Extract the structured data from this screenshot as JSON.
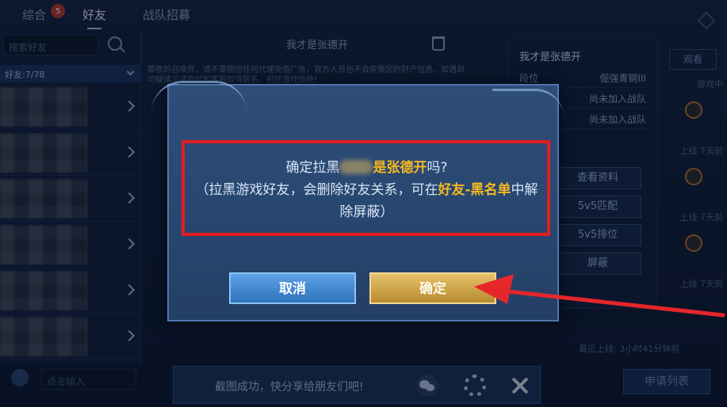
{
  "tabs": {
    "items": [
      {
        "label": "综合"
      },
      {
        "label": "好友"
      },
      {
        "label": "战队招募"
      }
    ],
    "badge": "5"
  },
  "friends": {
    "search_placeholder": "搜索好友",
    "count_label": "好友:7/78",
    "input_placeholder": "点击输入"
  },
  "chat": {
    "title": "我才是张德开",
    "notice": "尊敬的召唤师，请不要相信任何代理充值广告，官方人员也不会索要您的财产信息，如遇到可疑情况请及时和客服取得联系，祝您游戏愉快！"
  },
  "profile": {
    "name": "我才是张德开",
    "rows": [
      {
        "key": "段位",
        "value": "倔强青铜III"
      },
      {
        "key": "",
        "value": "尚未加入战队"
      },
      {
        "key": "",
        "value": "尚未加入战队"
      }
    ],
    "buttons": [
      {
        "label": "查看资料"
      },
      {
        "label": "5v5匹配"
      },
      {
        "label": "5v5排位"
      },
      {
        "label": "屏蔽"
      }
    ],
    "far_right_button": "观看",
    "online_lines": [
      "游戏中",
      "上线 7天前",
      "上线 7天前",
      "上线 7天前"
    ],
    "last_online": "最近上线: 3小时41分钟前",
    "apply_list": "申请列表"
  },
  "modal": {
    "line1_prefix": "确定拉黑",
    "line1_name_suffix": "是张德开",
    "line1_end": "吗?",
    "line2_prefix": "（拉黑游戏好友，会删除好友关系，可在",
    "line2_gold": "好友-黑名单",
    "line2_end": "中解除屏蔽）",
    "cancel_label": "取消",
    "confirm_label": "确定"
  },
  "share": {
    "text": "截图成功，快分享给朋友们吧!"
  },
  "colors": {
    "highlight": "#e21d21",
    "gold_text": "#f5b820",
    "arrow": "#e5262a"
  }
}
